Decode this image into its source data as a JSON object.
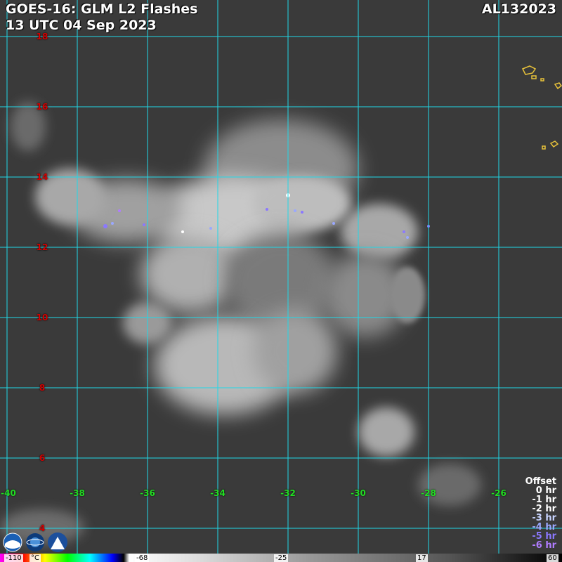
{
  "header": {
    "title": "GOES-16: GLM L2 Flashes",
    "datetime": "13 UTC 04 Sep 2023",
    "storm_id": "AL132023"
  },
  "grid": {
    "latitudes": [
      "18",
      "16",
      "14",
      "12",
      "10",
      "8",
      "6",
      "4"
    ],
    "longitudes": [
      "-40",
      "-38",
      "-36",
      "-34",
      "-32",
      "-30",
      "-28",
      "-26"
    ]
  },
  "legend": {
    "title": "Offset",
    "items": [
      {
        "label": "0 hr",
        "color": "#ffffff"
      },
      {
        "label": "-1 hr",
        "color": "#ffffff"
      },
      {
        "label": "-2 hr",
        "color": "#ffffff"
      },
      {
        "label": "-3 hr",
        "color": "#c8d4ff"
      },
      {
        "label": "-4 hr",
        "color": "#9aa8ff"
      },
      {
        "label": "-5 hr",
        "color": "#8b78ff"
      },
      {
        "label": "-6 hr",
        "color": "#b07cff"
      }
    ]
  },
  "colorbar": {
    "labels": [
      "-110",
      "°C",
      "-68",
      "-25",
      "17",
      "60"
    ]
  },
  "colors": {
    "gridline": "#20d8e8",
    "coastline": "#e8c23a",
    "background": "#3a3a3a"
  },
  "logos": [
    "noaa-logo",
    "nesdis-logo",
    "cira-logo"
  ]
}
